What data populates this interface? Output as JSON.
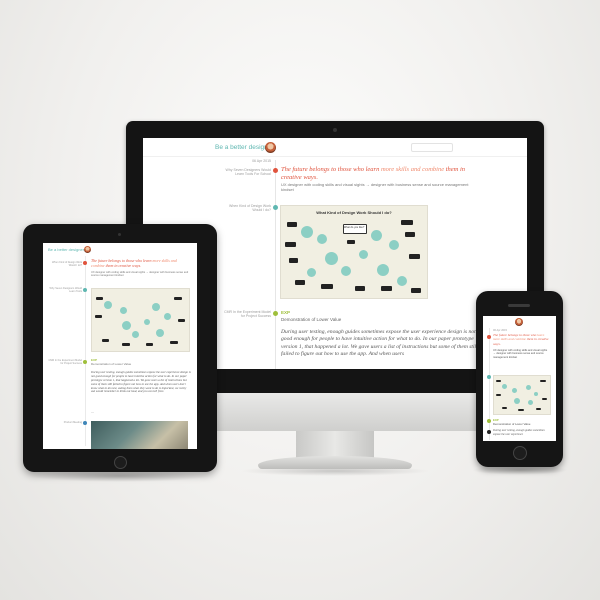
{
  "site": {
    "title": "Be a better designer"
  },
  "post1": {
    "date": "06 Apr 2015",
    "side_label": "Why Seven Designers Would Learn Tools For School",
    "quote_start": "The future belongs to those who learn ",
    "quote_highlight": "more skills and combine",
    "quote_end": " them in creative ways.",
    "body": "UX designer with coding skills and visual sights → designer with business sense and source management kindset"
  },
  "post2": {
    "side_label": "When Kind of Design Work Would I do?",
    "map_title": "What Kind of Design Work Should I do?",
    "map_center": "What do you like?"
  },
  "post3": {
    "side_label": "CMR In the Experiment Model for Project Success",
    "tag": "EXP",
    "tag_caption": "Demonstration of Lower Value",
    "italic_text": "During user testing, enough guides sometimes expose the user experience design is not good enough for people to have intuitive action for what to do. In our paper prototype version 1, that happened a lot. We gave users a list of instructions but some of them still failed to figure out how to use the app. And when users"
  },
  "ipad": {
    "title": "Be a better designer",
    "quote_start": "The future belongs to those who learn ",
    "quote_highlight": "more skills and combine",
    "quote_end": " them in creative ways.",
    "body": "UX designer with coding skills and visual sights → designer with business sense and source management kindset",
    "side1": "When Kind of Design Work Would I do?",
    "side2": "Why Seven Designers Would Learn Tools",
    "side3": "CMR In the Experiment Model for Project Success",
    "side4": "Product Meeting",
    "tag": "EXP",
    "tag_caption": "Demonstration of Lower Value",
    "italic_text": "During user testing, enough guides sometimes expose the user experience design is not good enough for people to have intuitive action for what to do. In our paper prototype version 1, that happened a lot. We gave users a list of instructions but some of them still failed to figure out how to use the app. And when users don't know what to do next, asking them what they want to do is important, we rarely ask would remember to think out loud, and you can tell from"
  },
  "iphone": {
    "date": "06 Apr 2015",
    "quote_start": "The future belongs to those who ",
    "quote_highlight": "learn more skills and combine",
    "quote_end": " them in creative ways.",
    "body": "UX designer with coding skills and visual sights → designer with business sense and source management kindset",
    "tag": "EXP",
    "tag_caption": "Demonstration of Lower Value",
    "italic_text": "During user testing, enough guides sometimes expose the user experience"
  },
  "colors": {
    "accent_teal": "#5fb7b1",
    "quote_red": "#e0533d",
    "tag_green": "#9fbf3b",
    "dot_blue": "#3f86b8",
    "map_bg": "#f1efe2"
  },
  "icons": [
    "avatar",
    "search-icon",
    "timeline-dot"
  ]
}
